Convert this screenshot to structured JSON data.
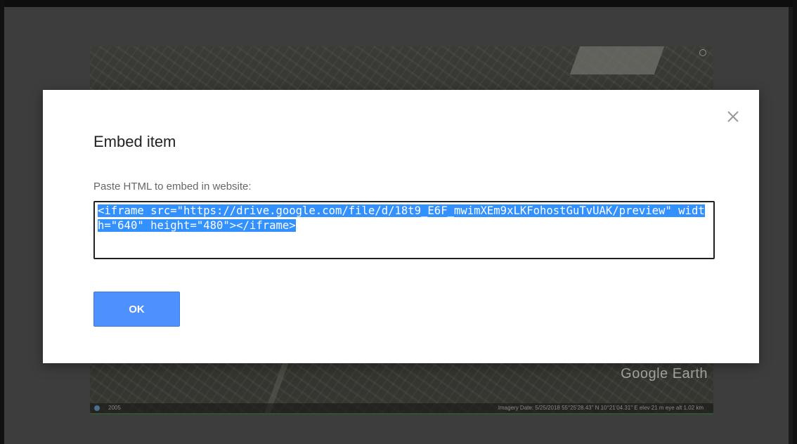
{
  "dialog": {
    "title": "Embed item",
    "field_label": "Paste HTML to embed in website:",
    "embed_code": "<iframe src=\"https://drive.google.com/file/d/18t9_E6F_mwimXEm9xLKFohostGuTvUAK/preview\" width=\"640\" height=\"480\"></iframe>",
    "ok_label": "OK",
    "close_icon": "close-icon"
  },
  "background_map": {
    "watermark": "Google Earth",
    "imagery_year": "2005",
    "status_info": "Imagery Date: 5/25/2018    55°25'28.43\" N   10°21'04.31\" E  elev  21 m   eye alt  1.02 km"
  },
  "colors": {
    "button_bg": "#4d90fe",
    "selection": "#3390ff",
    "dialog_bg": "#ffffff",
    "overlay": "#3d3d3d"
  }
}
